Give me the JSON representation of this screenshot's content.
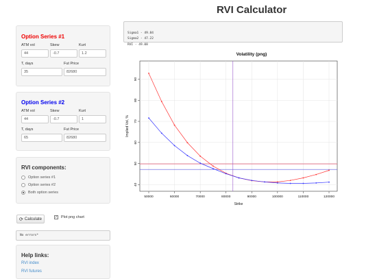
{
  "title": "RVI Calculator",
  "series1": {
    "title": "Option Series #1",
    "color": "#ee0000",
    "labels": {
      "atm": "ATM vol",
      "skew": "Skew",
      "kurt": "Kurt",
      "days": "T, days",
      "fut": "Fut Price"
    },
    "values": {
      "atm": "44",
      "skew": "-0.7",
      "kurt": "1.2",
      "days": "35",
      "fut": "82680"
    }
  },
  "series2": {
    "title": "Option Series #2",
    "color": "#0000ee",
    "labels": {
      "atm": "ATM vol",
      "skew": "Skew",
      "kurt": "Kurt",
      "days": "T, days",
      "fut": "Fut Price"
    },
    "values": {
      "atm": "44",
      "skew": "-0.7",
      "kurt": "1",
      "days": "65",
      "fut": "82680"
    }
  },
  "components": {
    "heading": "RVI components:",
    "options": [
      "Option series #1",
      "Option series #2",
      "Both option series"
    ],
    "selected": 2
  },
  "controls": {
    "calculate_label": "Calculate",
    "calculate_icon": "refresh-icon",
    "plot_label": "Plot png chart",
    "plot_checked": true
  },
  "errors_text": "No errors*",
  "help": {
    "heading": "Help links:",
    "links": [
      "RVI index",
      "RVI futures"
    ]
  },
  "output": {
    "line1": "Sigma1 - 49.84",
    "line2": "Sigma2 - 47.22",
    "line3": "RVI - 49.08"
  },
  "chart_data": {
    "type": "line",
    "title": "Volatility (png)",
    "xlabel": "Strike",
    "ylabel": "Implied Vol, %",
    "xlim": [
      50000,
      120000
    ],
    "ylim": [
      38.5,
      96
    ],
    "xticks": [
      50000,
      60000,
      70000,
      80000,
      90000,
      100000,
      110000,
      120000
    ],
    "yticks": [
      40,
      50,
      60,
      70,
      80,
      90
    ],
    "grid": true,
    "series": [
      {
        "color": "#ff3333",
        "x": [
          50000,
          55000,
          60000,
          65000,
          70000,
          75000,
          80000,
          85000,
          90000,
          95000,
          100000,
          105000,
          110000,
          115000,
          120000
        ],
        "values": [
          92.8,
          79.4,
          68.2,
          59.9,
          53.5,
          48.8,
          45.4,
          43.2,
          41.9,
          41.3,
          41.3,
          42.0,
          43.2,
          44.8,
          46.8
        ]
      },
      {
        "color": "#3333ff",
        "x": [
          50000,
          55000,
          60000,
          65000,
          70000,
          75000,
          80000,
          85000,
          90000,
          95000,
          100000,
          105000,
          110000,
          115000,
          120000
        ],
        "values": [
          71.6,
          64.4,
          58.5,
          53.8,
          50.2,
          47.6,
          45.2,
          43.2,
          42.0,
          41.3,
          40.8,
          40.6,
          40.6,
          40.8,
          41.2
        ]
      }
    ],
    "hlines": [
      {
        "y": 49.84,
        "color": "#dd3355"
      },
      {
        "y": 47.22,
        "color": "#5555dd"
      }
    ],
    "vlines": [
      {
        "x": 82680,
        "color": "#9955cc"
      }
    ]
  }
}
